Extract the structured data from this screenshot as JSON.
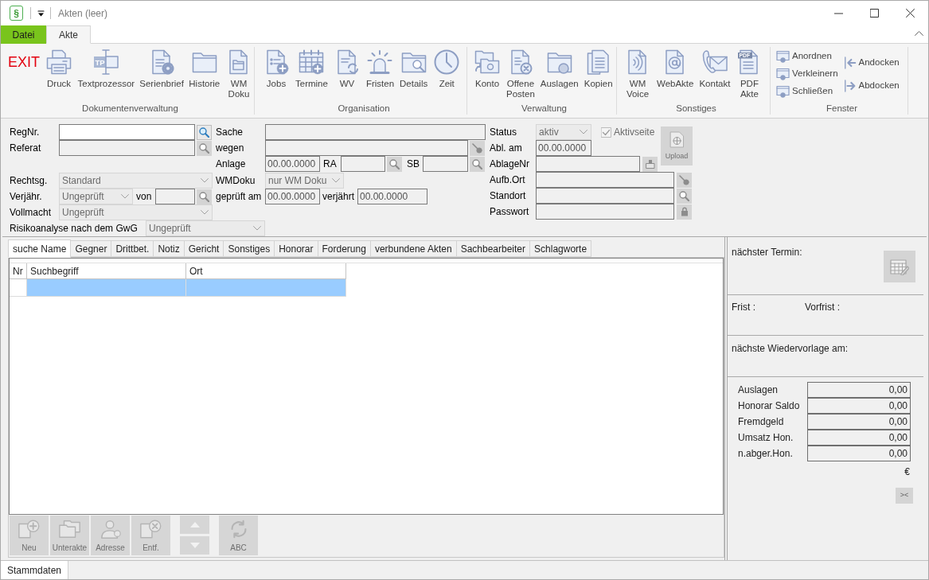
{
  "window": {
    "logo": "§",
    "title": "Akten (leer)"
  },
  "ribbon": {
    "tabs": [
      {
        "label": "Datei",
        "kind": "file",
        "selected": false
      },
      {
        "label": "Akte",
        "kind": "tab",
        "selected": true
      }
    ],
    "groups": [
      {
        "label": "Dokumentenverwaltung",
        "buttons": [
          {
            "kind": "exit",
            "label": "EXIT"
          },
          {
            "kind": "large",
            "label": "Druck"
          },
          {
            "kind": "large",
            "label": "Textprozessor",
            "icon_text": "TP"
          },
          {
            "kind": "large",
            "label": "Serienbrief"
          },
          {
            "kind": "large",
            "label": "Historie"
          },
          {
            "kind": "large",
            "label": "WM Doku"
          }
        ]
      },
      {
        "label": "Organisation",
        "buttons": [
          {
            "kind": "large",
            "label": "Jobs"
          },
          {
            "kind": "large",
            "label": "Termine"
          },
          {
            "kind": "large",
            "label": "WV"
          },
          {
            "kind": "large",
            "label": "Fristen"
          },
          {
            "kind": "large",
            "label": "Details"
          },
          {
            "kind": "large",
            "label": "Zeit"
          }
        ]
      },
      {
        "label": "Verwaltung",
        "buttons": [
          {
            "kind": "large",
            "label": "Konto"
          },
          {
            "kind": "large",
            "label": "Offene Posten"
          },
          {
            "kind": "large",
            "label": "Auslagen"
          },
          {
            "kind": "large",
            "label": "Kopien"
          }
        ]
      },
      {
        "label": "Sonstiges",
        "buttons": [
          {
            "kind": "large",
            "label": "WM Voice"
          },
          {
            "kind": "large",
            "label": "WebAkte"
          },
          {
            "kind": "large",
            "label": "Kontakt"
          },
          {
            "kind": "large",
            "label": "PDF Akte",
            "icon_text": "PDF"
          }
        ]
      },
      {
        "label": "Fenster",
        "buttons": [
          {
            "kind": "small",
            "label": "Anordnen"
          },
          {
            "kind": "small",
            "label": "Verkleinern"
          },
          {
            "kind": "small",
            "label": "Schließen"
          },
          {
            "kind": "dock",
            "label": "Andocken"
          },
          {
            "kind": "dock",
            "label": "Abdocken"
          }
        ]
      }
    ]
  },
  "form": {
    "regnr": {
      "label": "RegNr.",
      "disabled": false
    },
    "referat": {
      "label": "Referat",
      "disabled": true
    },
    "sache": {
      "label": "Sache",
      "disabled": true
    },
    "wegen": {
      "label": "wegen",
      "disabled": true
    },
    "anlage": {
      "label": "Anlage",
      "value": "00.00.0000",
      "disabled": true
    },
    "ra": {
      "label": "RA",
      "disabled": true
    },
    "sb": {
      "label": "SB",
      "disabled": true
    },
    "rechtsgebiet": {
      "label": "Rechtsg.",
      "value": "Standard",
      "disabled": true
    },
    "wmdoku": {
      "label": "WMDoku",
      "value": "nur WM Doku",
      "disabled": true
    },
    "verjaehrung": {
      "label": "Verjähr.",
      "value": "Ungeprüft",
      "disabled": true
    },
    "von": {
      "label": "von",
      "disabled": true
    },
    "geprueft_am": {
      "label": "geprüft am",
      "value": "00.00.0000",
      "disabled": true
    },
    "verjaehrt": {
      "label": "verjährt",
      "value": "00.00.0000",
      "disabled": true
    },
    "vollmacht": {
      "label": "Vollmacht",
      "value": "Ungeprüft",
      "disabled": true
    },
    "risikoanalyse": {
      "label": "Risikoanalyse nach dem GwG",
      "value": "Ungeprüft",
      "disabled": true
    },
    "status": {
      "label": "Status",
      "value": "aktiv",
      "disabled": true
    },
    "aktivseite": {
      "label": "Aktivseite",
      "checked": true,
      "disabled": true
    },
    "abl_am": {
      "label": "Abl. am",
      "value": "00.00.0000",
      "disabled": true
    },
    "ablagenr": {
      "label": "AblageNr",
      "disabled": true
    },
    "aufb_ort": {
      "label": "Aufb.Ort",
      "disabled": true
    },
    "standort": {
      "label": "Standort",
      "disabled": true
    },
    "passwort": {
      "label": "Passwort",
      "disabled": true
    },
    "upload": {
      "label": "Upload",
      "disabled": true
    }
  },
  "tabs": [
    {
      "label": "suche Name",
      "selected": true
    },
    {
      "label": "Gegner",
      "selected": false
    },
    {
      "label": "Drittbet.",
      "selected": false
    },
    {
      "label": "Notiz",
      "selected": false
    },
    {
      "label": "Gericht",
      "selected": false
    },
    {
      "label": "Sonstiges",
      "selected": false
    },
    {
      "label": "Honorar",
      "selected": false
    },
    {
      "label": "Forderung",
      "selected": false
    },
    {
      "label": "verbundene Akten",
      "selected": false
    },
    {
      "label": "Sachbearbeiter",
      "selected": false
    },
    {
      "label": "Schlagworte",
      "selected": false
    }
  ],
  "table": {
    "columns": [
      "Nr",
      "Suchbegriff",
      "Ort"
    ],
    "rows": [
      {
        "selected": true
      }
    ]
  },
  "toolbar": [
    {
      "kind": "large",
      "label": "Neu",
      "disabled": true
    },
    {
      "kind": "large",
      "label": "Unterakte",
      "disabled": true
    },
    {
      "kind": "large",
      "label": "Adresse",
      "disabled": true
    },
    {
      "kind": "large",
      "label": "Entf.",
      "disabled": true
    },
    {
      "kind": "stepper",
      "disabled": true
    },
    {
      "kind": "large",
      "label": "ABC",
      "disabled": true
    }
  ],
  "side_panel": {
    "next_appointment": "nächster Termin:",
    "calendar_button": {
      "disabled": true
    },
    "deadline": "Frist :",
    "pre_deadline": "Vorfrist :",
    "next_resubmission": "nächste Wiedervorlage am:",
    "amounts": [
      {
        "label": "Auslagen",
        "value": "0,00"
      },
      {
        "label": "Honorar Saldo",
        "value": "0,00"
      },
      {
        "label": "Fremdgeld",
        "value": "0,00"
      },
      {
        "label": "Umsatz Hon.",
        "value": "0,00"
      },
      {
        "label": "n.abger.Hon.",
        "value": "0,00"
      }
    ],
    "currency": "€",
    "toggle_button": "><"
  },
  "bottom_tabs": [
    {
      "label": "Stammdaten",
      "selected": true
    }
  ]
}
